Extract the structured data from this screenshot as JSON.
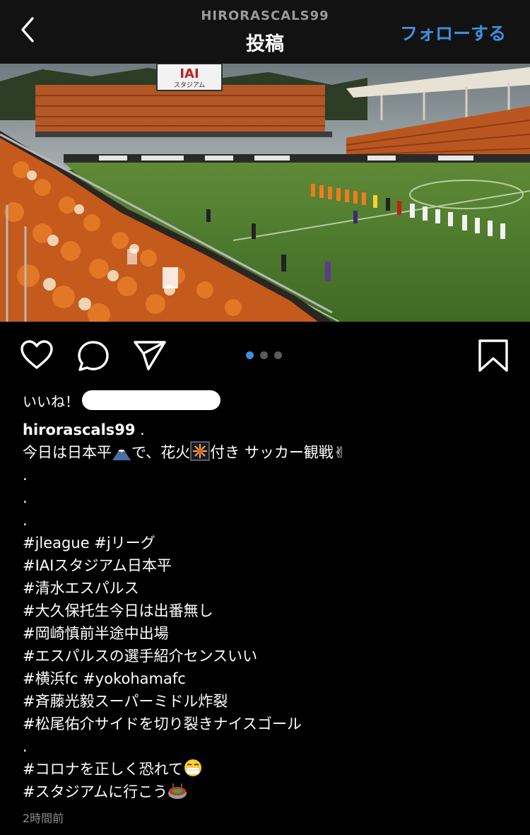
{
  "header": {
    "username": "HIRORASCALS99",
    "title": "投稿",
    "follow_label": "フォローする"
  },
  "photo": {
    "board_text": "IAI",
    "board_subtext": "スタジアム"
  },
  "carousel": {
    "count": 3,
    "active_index": 0,
    "active_color": "#3d8fe0"
  },
  "likes": {
    "label": "いいね！"
  },
  "caption": {
    "username": "hirorascals99",
    "username_suffix": " .",
    "line1_a": "今日は日本平",
    "line1_b": "で、花火",
    "line1_c": "付き サッカー観戦",
    "line1_emoji": "✌",
    "dot1": ".",
    "dot2": ".",
    "dot3": ".",
    "tags": [
      "#jleague #jリーグ",
      "#IAIスタジアム日本平",
      "#清水エスパルス",
      "#大久保托生今日は出番無し",
      "#岡崎慎前半途中出場",
      "#エスパルスの選手紹介センスいい",
      "#横浜fc #yokohamafc",
      "#斉藤光毅スーパーミドル炸裂",
      "#松尾佑介サイドを切り裂きナイスゴール"
    ],
    "dot4": ".",
    "tag_corona": "#コロナを正しく恐れて",
    "tag_stadium": "#スタジアムに行こう"
  },
  "timestamp": "2時間前",
  "colors": {
    "header_bg": "#121212",
    "accent": "#3d8fe0",
    "muted": "#8e8e8e"
  },
  "icons": {
    "back": "chevron-left-icon",
    "like": "heart-outline-icon",
    "comment": "speech-bubble-icon",
    "share": "paper-plane-icon",
    "save": "bookmark-icon"
  }
}
